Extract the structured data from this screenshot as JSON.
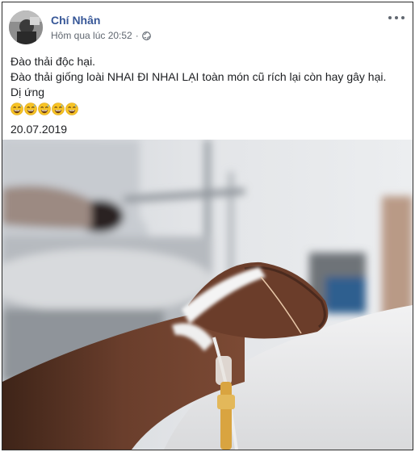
{
  "post": {
    "author": "Chí Nhân",
    "timestamp": "Hôm qua lúc 20:52",
    "separator": "·",
    "privacy_icon": "globe-icon",
    "more_icon": "more-options-icon",
    "lines": [
      "Đào thải độc hại.",
      "Đào thải giống loài NHAI ĐI NHAI LẠI toàn món cũ rích lại còn hay gây hại.",
      "Dị ứng"
    ],
    "emoji_count": 5,
    "emoji_name": "grinning-sweat-emoji",
    "date_text": "20.07.2019",
    "photo_icon": "hospital-iv-photo"
  },
  "colors": {
    "author": "#385898",
    "meta": "#606770",
    "emoji": "#f7c325"
  }
}
